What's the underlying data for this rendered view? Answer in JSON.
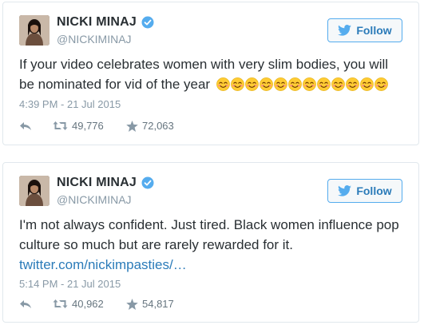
{
  "tweets": [
    {
      "display_name": "NICKI MINAJ",
      "handle": "@NICKIMINAJ",
      "follow_label": "Follow",
      "text": "If your video celebrates women with very slim bodies, you will be nominated for vid of the year",
      "emoji": "smiling-face-with-smiling-eyes",
      "emoji_count": 12,
      "link": "",
      "timestamp": "4:39 PM - 21 Jul 2015",
      "retweets": "49,776",
      "favorites": "72,063"
    },
    {
      "display_name": "NICKI MINAJ",
      "handle": "@NICKIMINAJ",
      "follow_label": "Follow",
      "text": "I'm not always confident.  Just tired. Black women influence pop culture so much but are rarely rewarded for it.",
      "emoji": "",
      "emoji_count": 0,
      "link": "twitter.com/nickimpasties/…",
      "timestamp": "5:14 PM - 21 Jul 2015",
      "retweets": "40,962",
      "favorites": "54,817"
    }
  ],
  "colors": {
    "accent": "#55acee",
    "link": "#2b7bb9",
    "muted": "#8899a6",
    "text": "#292f33",
    "border": "#e1e8ed"
  }
}
